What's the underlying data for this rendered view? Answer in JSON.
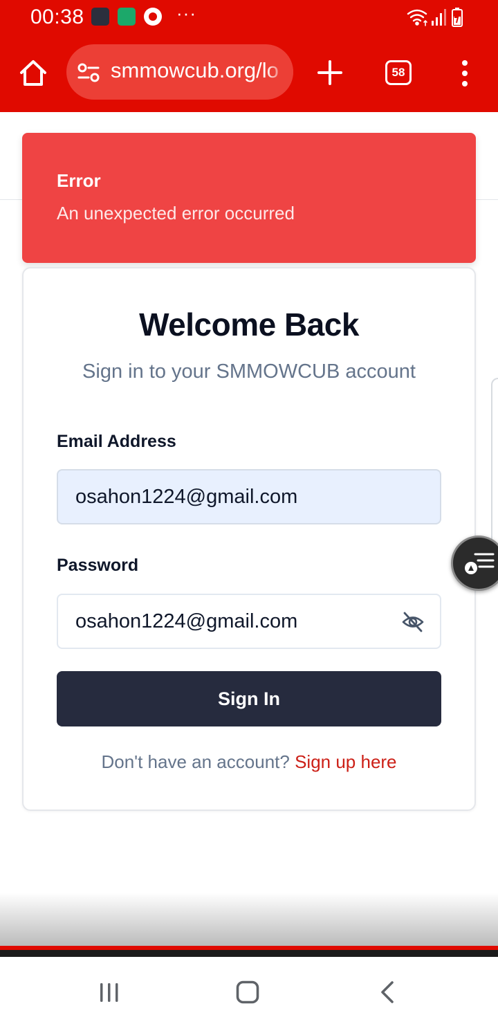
{
  "status_bar": {
    "time": "00:38",
    "more_indicator": "···",
    "icons": [
      "app-notification-icon",
      "game-notification-icon",
      "chrome-notification-icon",
      "wifi-icon",
      "signal-icon",
      "battery-charging-icon"
    ]
  },
  "browser": {
    "url": "smmowcub.org/lo",
    "tab_count": "58",
    "accent_color": "#e00a00"
  },
  "toast": {
    "title": "Error",
    "message": "An unexpected error occurred",
    "color": "#ef4444"
  },
  "login": {
    "title": "Welcome Back",
    "subtitle": "Sign in to your SMMOWCUB account",
    "email_label": "Email Address",
    "email_value": "osahon1224@gmail.com",
    "password_label": "Password",
    "password_value": "osahon1224@gmail.com",
    "submit_label": "Sign In",
    "signup_prompt": "Don't have an account?",
    "signup_link": "Sign up here",
    "button_color": "#262b3e",
    "link_color": "#cc1f16"
  },
  "navigation": {
    "buttons": [
      "recents-button",
      "home-button",
      "back-button"
    ]
  }
}
